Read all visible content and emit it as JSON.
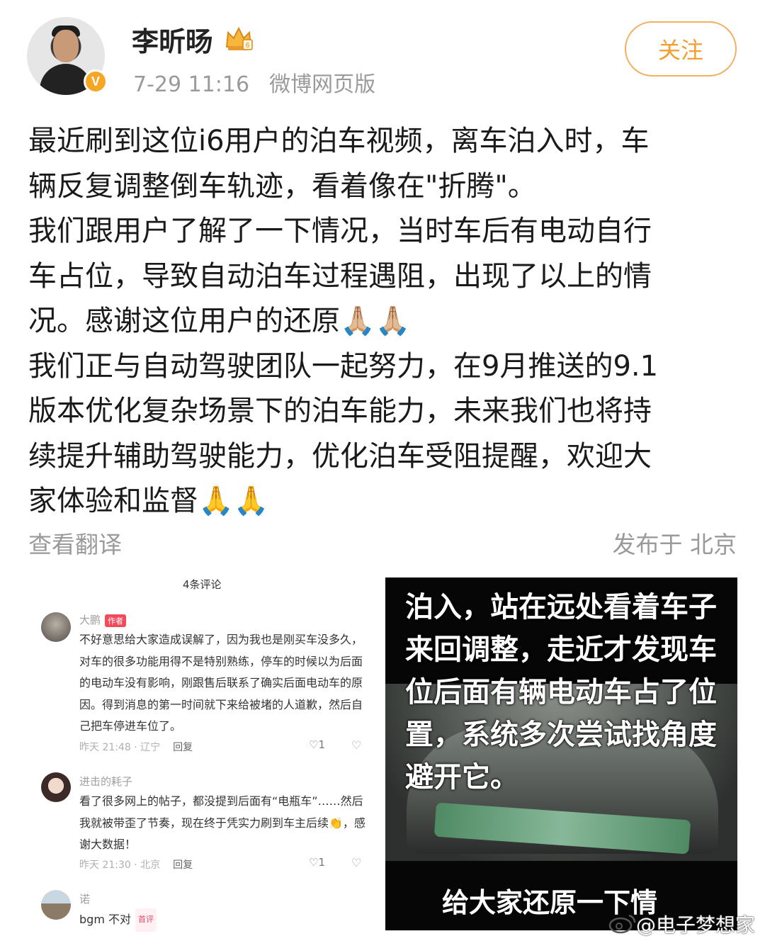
{
  "post": {
    "username": "李昕旸",
    "time": "7-29 11:16",
    "source": "微博网页版",
    "follow_label": "关注",
    "text": "最近刷到这位i6用户的泊车视频，离车泊入时，车\n辆反复调整倒车轨迹，看着像在\"折腾\"。\n我们跟用户了解了一下情况，当时车后有电动自行\n车占位，导致自动泊车过程遇阻，出现了以上的情\n况。感谢这位用户的还原🙏🏼🙏🏼\n我们正与自动驾驶团队一起努力，在9月推送的9.1\n版本优化复杂场景下的泊车能力，未来我们也将持\n续提升辅助驾驶能力，优化泊车受阻提醒，欢迎大\n家体验和监督🙏🙏",
    "translate_label": "查看翻译",
    "location_label": "发布于 北京"
  },
  "comments_screenshot": {
    "title": "4条评论",
    "comments": [
      {
        "name": "大鹏",
        "tag": "作者",
        "text": "不好意思给大家造成误解了，因为我也是刚买车没多久，对车的很多功能用得不是特别熟练，停车的时候以为后面的电动车没有影响，刚跟售后联系了确实后面电动车的原因。得到消息的第一时间就下来给被堵的人道歉，然后自己把车停进车位了。",
        "time_loc": "昨天 21:48 · 辽宁",
        "reply": "回复",
        "likes": "1"
      },
      {
        "name": "进击的耗子",
        "tag": "",
        "text": "看了很多网上的帖子，都没提到后面有“电瓶车”……然后我就被带歪了节奏，现在终于凭实力刷到车主后续👏，感谢大数据！",
        "time_loc": "昨天 21:30 · 北京",
        "reply": "回复",
        "likes": "1"
      },
      {
        "name": "诺",
        "tag": "首评",
        "text": "bgm 不对"
      }
    ]
  },
  "video": {
    "caption": "泊入，站在远处看着车子来回调整，走近才发现车位后面有辆电动车占了位置，系统多次尝试找角度避开它。",
    "caption2": "给大家还原一下情"
  },
  "watermark": "@电子梦想家",
  "colors": {
    "follow": "#f29f2f",
    "author_tag": "#f24b5b",
    "verified": "#f5a623"
  }
}
